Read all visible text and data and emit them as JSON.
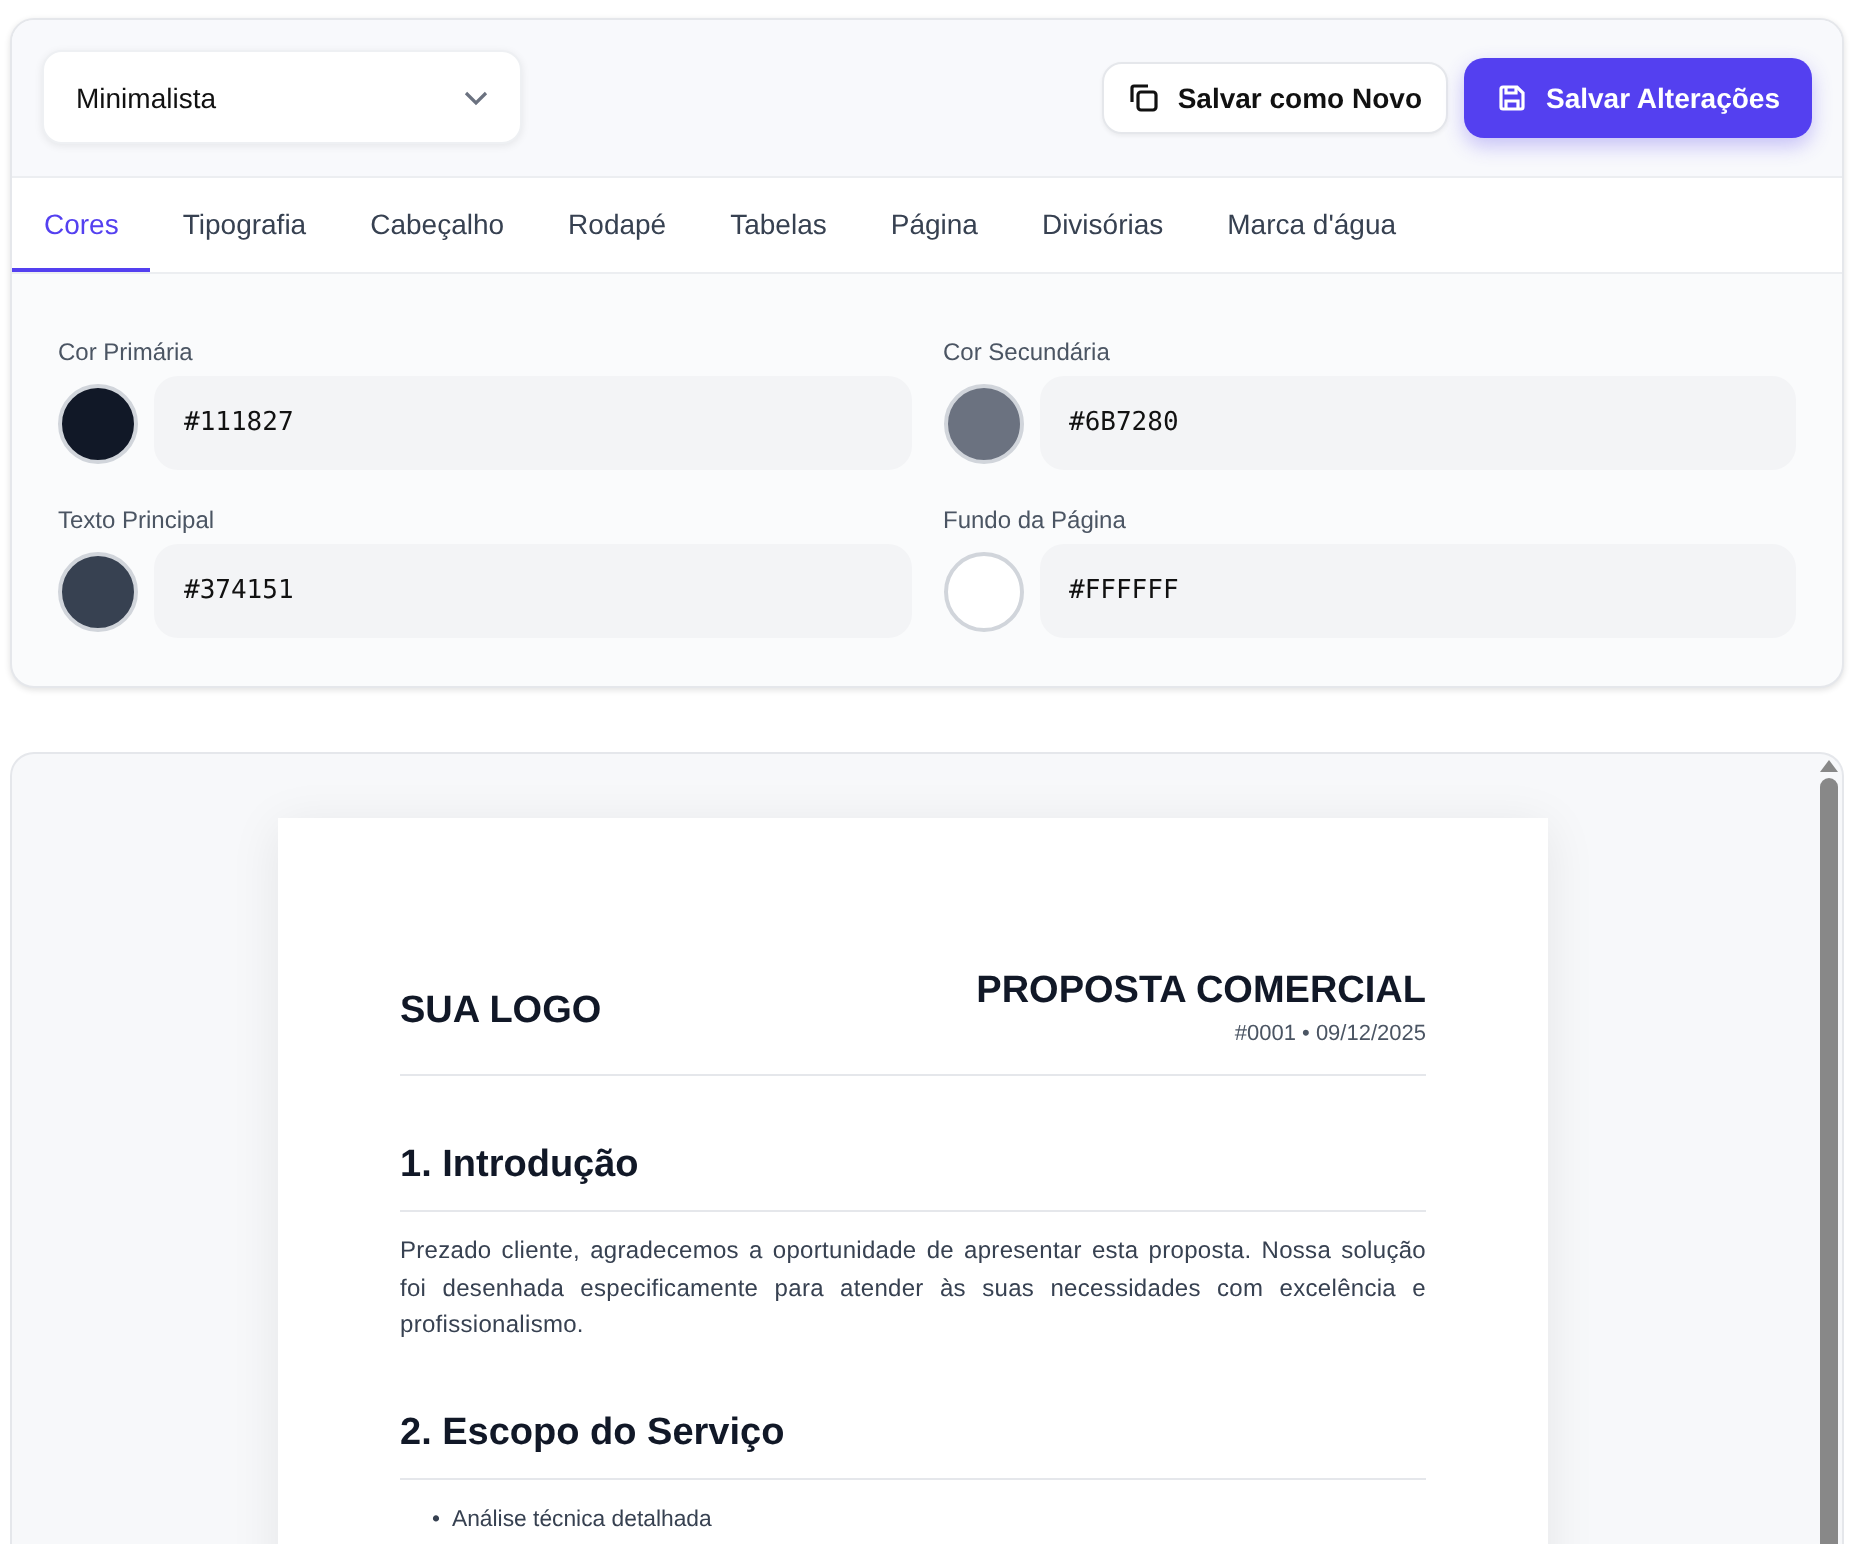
{
  "template_select": {
    "value": "Minimalista"
  },
  "buttons": [
    {
      "label": "Salvar como Novo",
      "kind": "secondary"
    },
    {
      "label": "Salvar Alterações",
      "kind": "primary"
    }
  ],
  "tabs": [
    {
      "label": "Cores",
      "selected": true
    },
    {
      "label": "Tipografia",
      "selected": false
    },
    {
      "label": "Cabeçalho",
      "selected": false
    },
    {
      "label": "Rodapé",
      "selected": false
    },
    {
      "label": "Tabelas",
      "selected": false
    },
    {
      "label": "Página",
      "selected": false
    },
    {
      "label": "Divisórias",
      "selected": false
    },
    {
      "label": "Marca d'água",
      "selected": false
    }
  ],
  "colors": [
    {
      "label": "Cor Primária",
      "value": "#111827",
      "color": "#111827"
    },
    {
      "label": "Cor Secundária",
      "value": "#6B7280",
      "color": "#6b7280"
    },
    {
      "label": "Texto Principal",
      "value": "#374151",
      "color": "#374151"
    },
    {
      "label": "Fundo da Página",
      "value": "#FFFFFF",
      "color": "#ffffff"
    }
  ],
  "document": {
    "logo": "SUA LOGO",
    "title": "PROPOSTA COMERCIAL",
    "meta": "#0001 • 09/12/2025",
    "sections": [
      {
        "heading": "1. Introdução",
        "paragraph": "Prezado cliente, agradecemos a oportunidade de apresentar esta proposta. Nossa solução foi desenhada especificamente para atender às suas necessidades com excelência e profissionalismo."
      },
      {
        "heading": "2. Escopo do Serviço",
        "bullets": [
          {
            "marker": "•",
            "text": "Análise técnica detalhada"
          }
        ]
      }
    ]
  }
}
